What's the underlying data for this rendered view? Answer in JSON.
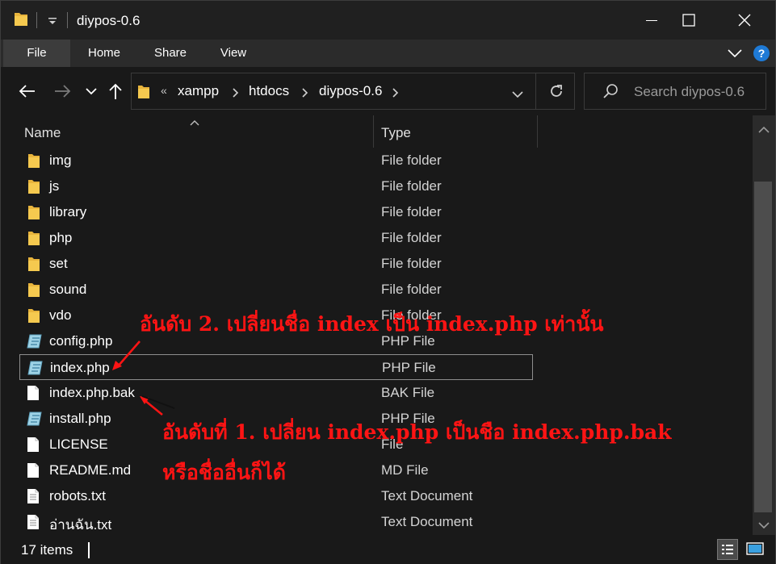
{
  "window": {
    "title": "diypos-0.6",
    "controls": {
      "minimize": "minimize",
      "maximize": "maximize",
      "close": "close"
    }
  },
  "ribbon": {
    "tabs": [
      "File",
      "Home",
      "Share",
      "View"
    ]
  },
  "nav": {
    "breadcrumb_overflow": "«",
    "breadcrumbs": [
      "xampp",
      "htdocs",
      "diypos-0.6"
    ],
    "search_placeholder": "Search diypos-0.6"
  },
  "columns": {
    "name": "Name",
    "type": "Type"
  },
  "files": [
    {
      "name": "img",
      "type": "File folder",
      "icon": "folder-icon"
    },
    {
      "name": "js",
      "type": "File folder",
      "icon": "folder-icon"
    },
    {
      "name": "library",
      "type": "File folder",
      "icon": "folder-icon"
    },
    {
      "name": "php",
      "type": "File folder",
      "icon": "folder-icon"
    },
    {
      "name": "set",
      "type": "File folder",
      "icon": "folder-icon"
    },
    {
      "name": "sound",
      "type": "File folder",
      "icon": "folder-icon"
    },
    {
      "name": "vdo",
      "type": "File folder",
      "icon": "folder-icon"
    },
    {
      "name": "config.php",
      "type": "PHP File",
      "icon": "php-file-icon"
    },
    {
      "name": "index.php",
      "type": "PHP File",
      "icon": "php-file-icon",
      "selected": true
    },
    {
      "name": "index.php.bak",
      "type": "BAK File",
      "icon": "blank-file-icon"
    },
    {
      "name": "install.php",
      "type": "PHP File",
      "icon": "php-file-icon"
    },
    {
      "name": "LICENSE",
      "type": "File",
      "icon": "blank-file-icon"
    },
    {
      "name": "README.md",
      "type": "MD File",
      "icon": "blank-file-icon"
    },
    {
      "name": "robots.txt",
      "type": "Text Document",
      "icon": "text-file-icon"
    },
    {
      "name": "อ่านฉัน.txt",
      "type": "Text Document",
      "icon": "text-file-icon"
    }
  ],
  "status": {
    "item_count": "17 items"
  },
  "annotations": {
    "step2": "อันดับ  2.  เปลี่ยนชื่อ  index  เป็น  index.php  เท่านั้น",
    "step1_line1": "อันดับที่  1.  เปลี่ยน  index.php  เป็นชือ  index.php.bak",
    "step1_line2": "หรือชื่ออื่นก็ได้"
  },
  "colors": {
    "background": "#191919",
    "ribbon": "#2b2b2b",
    "annotation": "#ff1414",
    "folder": "#e8b43c",
    "help": "#1e7ad6"
  }
}
